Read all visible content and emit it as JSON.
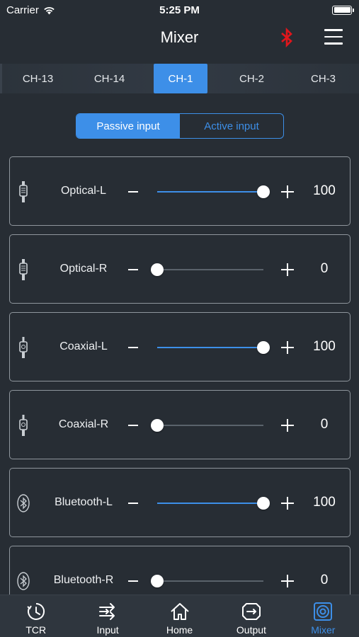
{
  "status": {
    "carrier": "Carrier",
    "time": "5:25 PM"
  },
  "header": {
    "title": "Mixer",
    "bluetooth_icon": "bluetooth-icon",
    "menu_icon": "menu-icon"
  },
  "channels": [
    "CH-13",
    "CH-14",
    "CH-1",
    "CH-2",
    "CH-3"
  ],
  "active_channel": "CH-1",
  "input_mode": {
    "passive_label": "Passive input",
    "active_label": "Active input",
    "selected": "Passive input"
  },
  "sources": [
    {
      "label": "Optical-L",
      "value": "100",
      "level": 1.0,
      "icon": "optical-plug-icon"
    },
    {
      "label": "Optical-R",
      "value": "0",
      "level": 0.0,
      "icon": "optical-plug-icon"
    },
    {
      "label": "Coaxial-L",
      "value": "100",
      "level": 1.0,
      "icon": "coaxial-plug-icon"
    },
    {
      "label": "Coaxial-R",
      "value": "0",
      "level": 0.0,
      "icon": "coaxial-plug-icon"
    },
    {
      "label": "Bluetooth-L",
      "value": "100",
      "level": 1.0,
      "icon": "bluetooth-icon"
    },
    {
      "label": "Bluetooth-R",
      "value": "0",
      "level": 0.0,
      "icon": "bluetooth-icon"
    }
  ],
  "tabs": [
    {
      "label": "TCR",
      "icon": "clock-icon"
    },
    {
      "label": "Input",
      "icon": "input-arrows-icon"
    },
    {
      "label": "Home",
      "icon": "home-icon"
    },
    {
      "label": "Output",
      "icon": "output-icon"
    },
    {
      "label": "Mixer",
      "icon": "mixer-icon"
    }
  ],
  "active_tab": "Mixer",
  "colors": {
    "accent": "#3d8fe8",
    "background": "#272d34",
    "bluetooth_header": "#e0161c"
  }
}
